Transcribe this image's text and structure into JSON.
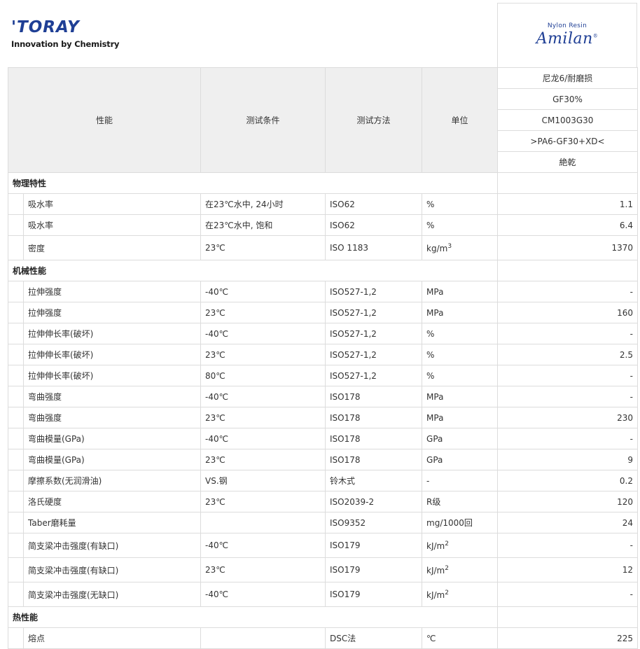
{
  "header": {
    "company": "'TORAY",
    "tagline": "Innovation by Chemistry",
    "brand_sub": "Nylon Resin",
    "brand_name": "Amilan"
  },
  "columns": {
    "property": "性能",
    "condition": "测试条件",
    "method": "测试方法",
    "unit": "单位"
  },
  "product": {
    "type": "尼龙6/耐磨损",
    "filler": "GF30%",
    "grade": "CM1003G30",
    "code": ">PA6-GF30+XD<",
    "state": "絶乾"
  },
  "sections": [
    {
      "title": "物理特性",
      "rows": [
        {
          "property": "吸水率",
          "condition": "在23℃水中, 24小时",
          "method": "ISO62",
          "unit": "%",
          "value": "1.1"
        },
        {
          "property": "吸水率",
          "condition": "在23℃水中, 饱和",
          "method": "ISO62",
          "unit": "%",
          "value": "6.4"
        },
        {
          "property": "密度",
          "condition": "23℃",
          "method": "ISO 1183",
          "unit": "kg/m",
          "unit_sup": "3",
          "value": "1370"
        }
      ]
    },
    {
      "title": "机械性能",
      "rows": [
        {
          "property": "拉伸强度",
          "condition": "-40℃",
          "method": "ISO527-1,2",
          "unit": "MPa",
          "value": "-"
        },
        {
          "property": "拉伸强度",
          "condition": "23℃",
          "method": "ISO527-1,2",
          "unit": "MPa",
          "value": "160"
        },
        {
          "property": "拉伸伸长率(破坏)",
          "condition": "-40℃",
          "method": "ISO527-1,2",
          "unit": "%",
          "value": "-"
        },
        {
          "property": "拉伸伸长率(破坏)",
          "condition": "23℃",
          "method": "ISO527-1,2",
          "unit": "%",
          "value": "2.5"
        },
        {
          "property": "拉伸伸长率(破坏)",
          "condition": "80℃",
          "method": "ISO527-1,2",
          "unit": "%",
          "value": "-"
        },
        {
          "property": "弯曲强度",
          "condition": "-40℃",
          "method": "ISO178",
          "unit": "MPa",
          "value": "-"
        },
        {
          "property": "弯曲强度",
          "condition": "23℃",
          "method": "ISO178",
          "unit": "MPa",
          "value": "230"
        },
        {
          "property": "弯曲模量(GPa)",
          "condition": "-40℃",
          "method": "ISO178",
          "unit": "GPa",
          "value": "-"
        },
        {
          "property": "弯曲模量(GPa)",
          "condition": "23℃",
          "method": "ISO178",
          "unit": "GPa",
          "value": "9"
        },
        {
          "property": "摩擦系数(无润滑油)",
          "condition": "VS.钢",
          "method": "铃木式",
          "unit": "-",
          "value": "0.2"
        },
        {
          "property": "洛氏硬度",
          "condition": "23℃",
          "method": "ISO2039-2",
          "unit": "R级",
          "value": "120"
        },
        {
          "property": "Taber磨耗量",
          "condition": "",
          "method": "ISO9352",
          "unit": "mg/1000回",
          "value": "24"
        },
        {
          "property": "简支梁冲击强度(有缺口)",
          "condition": "-40℃",
          "method": "ISO179",
          "unit": "kJ/m",
          "unit_sup": "2",
          "value": "-"
        },
        {
          "property": "简支梁冲击强度(有缺口)",
          "condition": "23℃",
          "method": "ISO179",
          "unit": "kJ/m",
          "unit_sup": "2",
          "value": "12"
        },
        {
          "property": "简支梁冲击强度(无缺口)",
          "condition": "-40℃",
          "method": "ISO179",
          "unit": "kJ/m",
          "unit_sup": "2",
          "value": "-"
        }
      ]
    },
    {
      "title": "热性能",
      "rows": [
        {
          "property": "熔点",
          "condition": "",
          "method": "DSC法",
          "unit": "℃",
          "value": "225"
        }
      ]
    }
  ]
}
